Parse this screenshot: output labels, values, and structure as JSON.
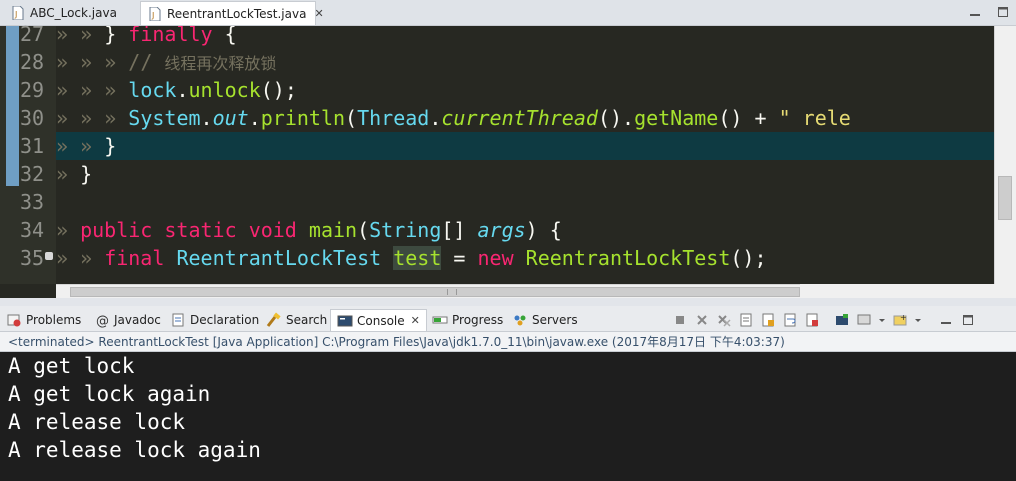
{
  "editor_tabs": [
    {
      "label": "ABC_Lock.java",
      "active": false
    },
    {
      "label": "ReentrantLockTest.java",
      "active": true,
      "close": "✕"
    }
  ],
  "code": {
    "line_numbers": [
      "27",
      "28",
      "29",
      "30",
      "31",
      "32",
      "33",
      "34",
      "35"
    ],
    "lines": [
      {
        "tokens": [
          [
            "ws",
            "» "
          ],
          [
            "ws",
            "» "
          ],
          [
            "",
            "} "
          ],
          [
            "kw",
            "finally"
          ],
          [
            "",
            " {"
          ]
        ]
      },
      {
        "tokens": [
          [
            "ws",
            "» "
          ],
          [
            "ws",
            "» "
          ],
          [
            "ws",
            "» "
          ],
          [
            "cm",
            "// "
          ],
          [
            "cmzh",
            "线程再次释放锁"
          ]
        ]
      },
      {
        "tokens": [
          [
            "ws",
            "» "
          ],
          [
            "ws",
            "» "
          ],
          [
            "ws",
            "» "
          ],
          [
            "tp",
            "lock"
          ],
          [
            "",
            "."
          ],
          [
            "fn",
            "unlock"
          ],
          [
            "",
            "();"
          ]
        ]
      },
      {
        "tokens": [
          [
            "ws",
            "» "
          ],
          [
            "ws",
            "» "
          ],
          [
            "ws",
            "» "
          ],
          [
            "tp",
            "System"
          ],
          [
            "",
            "."
          ],
          [
            "tp it",
            "out"
          ],
          [
            "",
            "."
          ],
          [
            "fn",
            "println"
          ],
          [
            "",
            "("
          ],
          [
            "tp",
            "Thread"
          ],
          [
            "",
            "."
          ],
          [
            "fn it",
            "currentThread"
          ],
          [
            "",
            "()."
          ],
          [
            "fn",
            "getName"
          ],
          [
            "",
            "() + "
          ],
          [
            "str",
            "\" rele"
          ]
        ]
      },
      {
        "tokens": [
          [
            "ws",
            "» "
          ],
          [
            "ws",
            "» "
          ],
          [
            "",
            "}"
          ]
        ]
      },
      {
        "tokens": [
          [
            "ws",
            "» "
          ],
          [
            "",
            "}"
          ]
        ]
      },
      {
        "tokens": []
      },
      {
        "tokens": [
          [
            "ws",
            "» "
          ],
          [
            "kw",
            "public"
          ],
          [
            "",
            " "
          ],
          [
            "kw",
            "static"
          ],
          [
            "",
            " "
          ],
          [
            "kw",
            "void"
          ],
          [
            "",
            " "
          ],
          [
            "fn",
            "main"
          ],
          [
            "",
            "("
          ],
          [
            "tp",
            "String"
          ],
          [
            "",
            "[] "
          ],
          [
            "tp it",
            "args"
          ],
          [
            "",
            ") {"
          ]
        ]
      },
      {
        "tokens": [
          [
            "ws",
            "» "
          ],
          [
            "ws",
            "» "
          ],
          [
            "kw",
            "final"
          ],
          [
            "",
            " "
          ],
          [
            "tp",
            "ReentrantLockTest"
          ],
          [
            "",
            " "
          ],
          [
            "fn hl",
            "test"
          ],
          [
            "",
            " = "
          ],
          [
            "kw",
            "new"
          ],
          [
            "",
            " "
          ],
          [
            "fn",
            "ReentrantLockTest"
          ],
          [
            "",
            "();"
          ]
        ]
      }
    ]
  },
  "views": [
    {
      "label": "Problems",
      "icon": "problems-icon"
    },
    {
      "label": "Javadoc",
      "icon": "javadoc-icon"
    },
    {
      "label": "Declaration",
      "icon": "declaration-icon"
    },
    {
      "label": "Search",
      "icon": "search-icon"
    },
    {
      "label": "Console",
      "icon": "console-icon",
      "active": true,
      "close": "✕"
    },
    {
      "label": "Progress",
      "icon": "progress-icon"
    },
    {
      "label": "Servers",
      "icon": "servers-icon"
    }
  ],
  "console": {
    "status": "<terminated> ReentrantLockTest [Java Application] C:\\Program Files\\Java\\jdk1.7.0_11\\bin\\javaw.exe (2017年8月17日 下午4:03:37)",
    "output": [
      "A get lock",
      "A get lock again",
      "A release lock",
      "A release lock again"
    ]
  },
  "colors": {
    "editor_bg": "#272822",
    "current_line": "#0e3a42",
    "keyword": "#f92672",
    "type": "#66d9ef",
    "function": "#a6e22e",
    "comment": "#75715e",
    "string": "#e6db74",
    "console_bg": "#1e1e1e"
  }
}
